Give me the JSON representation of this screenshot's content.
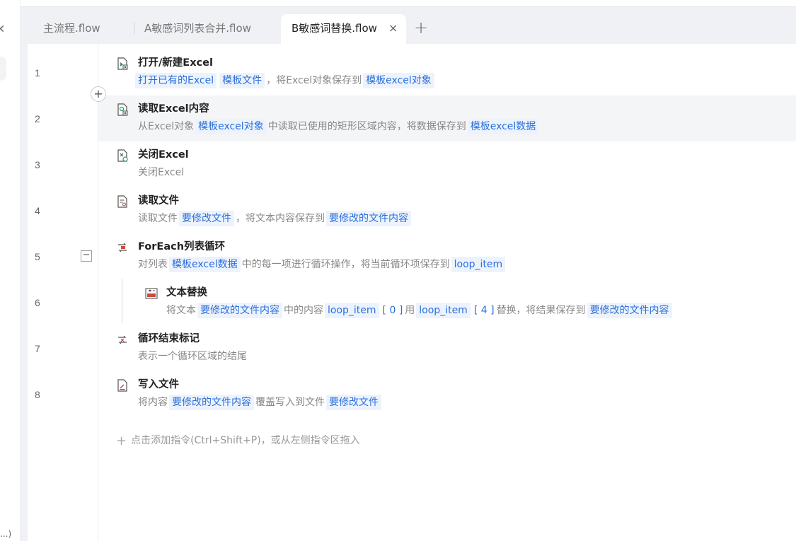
{
  "left": {
    "bottom_text": "...)"
  },
  "tabs": [
    {
      "label": "主流程.flow",
      "active": false
    },
    {
      "label": "A敏感词列表合并.flow",
      "active": false
    },
    {
      "label": "B敏感词替换.flow",
      "active": true
    }
  ],
  "tab_close": "×",
  "tab_add": "+",
  "lines": [
    "1",
    "2",
    "3",
    "4",
    "5",
    "6",
    "7",
    "8"
  ],
  "steps": [
    {
      "title": "打开/新建Excel",
      "desc": [
        {
          "t": "tag",
          "v": "打开已有的Excel"
        },
        {
          "t": "tag",
          "v": "模板文件"
        },
        {
          "t": "plain",
          "v": "，将Excel对象保存到"
        },
        {
          "t": "tag",
          "v": "模板excel对象"
        }
      ],
      "icon": "excel-open-icon"
    },
    {
      "title": "读取Excel内容",
      "desc": [
        {
          "t": "plain",
          "v": "从Excel对象"
        },
        {
          "t": "tag",
          "v": "模板excel对象"
        },
        {
          "t": "plain",
          "v": "中读取已使用的矩形区域内容，将数据保存到"
        },
        {
          "t": "tag",
          "v": "模板excel数据"
        }
      ],
      "icon": "excel-read-icon"
    },
    {
      "title": "关闭Excel",
      "desc": [
        {
          "t": "plain",
          "v": "关闭Excel"
        }
      ],
      "icon": "excel-close-icon"
    },
    {
      "title": "读取文件",
      "desc": [
        {
          "t": "plain",
          "v": "读取文件"
        },
        {
          "t": "tag",
          "v": "要修改文件"
        },
        {
          "t": "plain",
          "v": "，将文本内容保存到"
        },
        {
          "t": "tag",
          "v": "要修改的文件内容"
        }
      ],
      "icon": "file-read-icon"
    },
    {
      "title": "ForEach列表循环",
      "desc": [
        {
          "t": "plain",
          "v": "对列表"
        },
        {
          "t": "tag",
          "v": "模板excel数据"
        },
        {
          "t": "plain",
          "v": "中的每一项进行循环操作，将当前循环项保存到"
        },
        {
          "t": "tag",
          "v": "loop_item"
        }
      ],
      "icon": "foreach-loop-icon"
    },
    {
      "title": "文本替换",
      "desc": [
        {
          "t": "plain",
          "v": "将文本"
        },
        {
          "t": "tag",
          "v": "要修改的文件内容"
        },
        {
          "t": "plain",
          "v": "中的内容"
        },
        {
          "t": "tag",
          "v": "loop_item"
        },
        {
          "t": "bracket",
          "v": "[ 0 ]"
        },
        {
          "t": "plain",
          "v": "用"
        },
        {
          "t": "tag",
          "v": "loop_item"
        },
        {
          "t": "bracket",
          "v": "[ 4 ]"
        },
        {
          "t": "plain",
          "v": "替换，将结果保存到"
        },
        {
          "t": "tag",
          "v": "要修改的文件内容"
        }
      ],
      "icon": "text-replace-icon"
    },
    {
      "title": "循环结束标记",
      "desc": [
        {
          "t": "plain",
          "v": "表示一个循环区域的结尾"
        }
      ],
      "icon": "loop-end-icon"
    },
    {
      "title": "写入文件",
      "desc": [
        {
          "t": "plain",
          "v": "将内容"
        },
        {
          "t": "tag",
          "v": "要修改的文件内容"
        },
        {
          "t": "plain",
          "v": "覆盖写入到文件"
        },
        {
          "t": "tag",
          "v": "要修改文件"
        }
      ],
      "icon": "file-write-icon"
    }
  ],
  "add_command": "点击添加指令(Ctrl+Shift+P)，或从左侧指令区拖入",
  "colors": {
    "tag_bg": "#edf3fd",
    "tag_text": "#2a6fdb",
    "highlight_row": "#f4f5f7"
  }
}
